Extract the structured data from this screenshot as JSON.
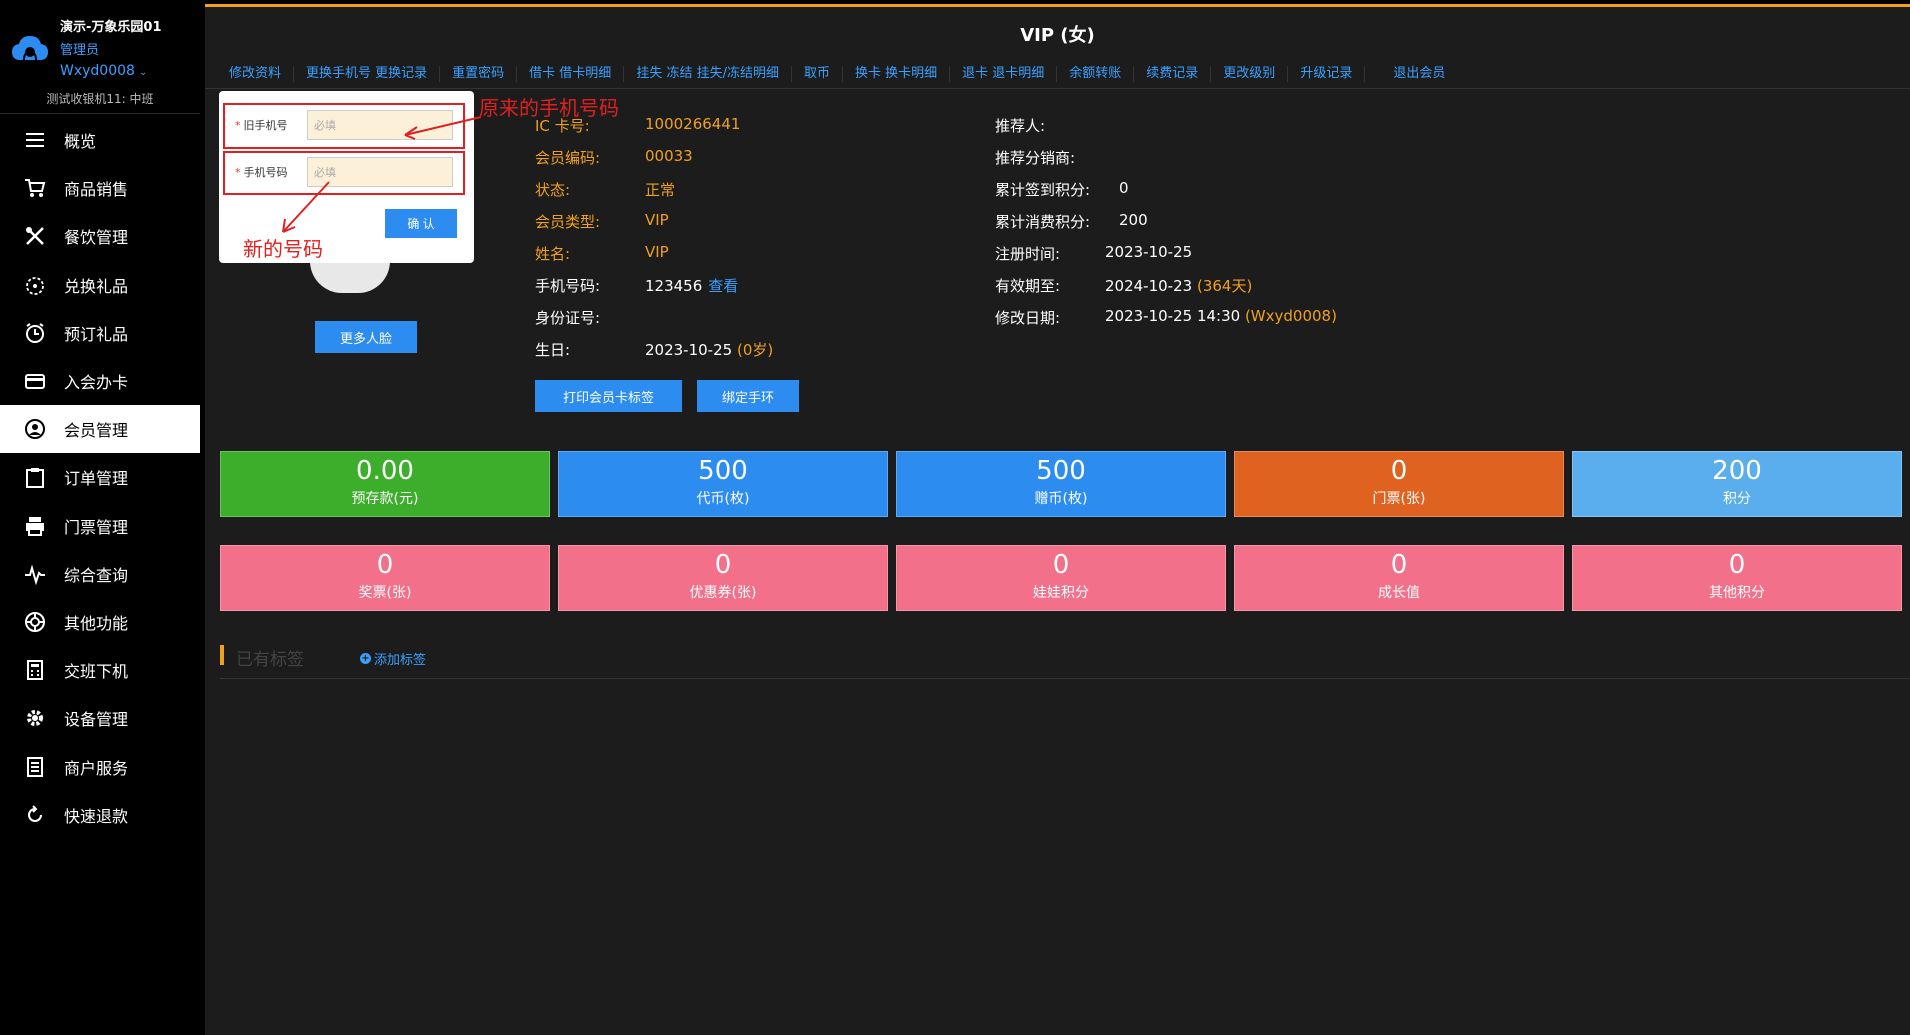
{
  "brand": {
    "store": "演示-万象乐园01",
    "role": "管理员",
    "user": "Wxyd0008",
    "terminal": "测试收银机11: 中班"
  },
  "nav": [
    {
      "label": "概览",
      "icon": "menu-icon"
    },
    {
      "label": "商品销售",
      "icon": "cart-icon"
    },
    {
      "label": "餐饮管理",
      "icon": "utensils-icon"
    },
    {
      "label": "兑换礼品",
      "icon": "gift-icon"
    },
    {
      "label": "预订礼品",
      "icon": "clock-icon"
    },
    {
      "label": "入会办卡",
      "icon": "card-icon"
    },
    {
      "label": "会员管理",
      "icon": "user-icon"
    },
    {
      "label": "订单管理",
      "icon": "clipboard-icon"
    },
    {
      "label": "门票管理",
      "icon": "printer-icon"
    },
    {
      "label": "综合查询",
      "icon": "pulse-icon"
    },
    {
      "label": "其他功能",
      "icon": "aperture-icon"
    },
    {
      "label": "交班下机",
      "icon": "calculator-icon"
    },
    {
      "label": "设备管理",
      "icon": "gear-icon"
    },
    {
      "label": "商户服务",
      "icon": "document-icon"
    },
    {
      "label": "快速退款",
      "icon": "refresh-icon"
    }
  ],
  "active_nav": "会员管理",
  "title": "VIP (女)",
  "tabs": [
    "修改资料",
    "更换手机号 更换记录",
    "重置密码",
    "借卡 借卡明细",
    "挂失 冻结 挂失/冻结明细",
    "取币",
    "换卡 换卡明细",
    "退卡 退卡明细",
    "余额转账",
    "续费记录",
    "更改级别",
    "升级记录",
    "退出会员"
  ],
  "popup": {
    "old_phone_label": "旧手机号",
    "new_phone_label": "手机号码",
    "placeholder": "必填",
    "confirm": "确 认",
    "annot_old": "原来的手机号码",
    "annot_new": "新的号码"
  },
  "more_face": "更多人脸",
  "info_left": [
    {
      "label": "IC 卡号:",
      "value": "1000266441",
      "label_color": "orange"
    },
    {
      "label": "会员编码:",
      "value": "00033",
      "label_color": "orange"
    },
    {
      "label": "状态:",
      "value": "正常",
      "label_color": "orange"
    },
    {
      "label": "会员类型:",
      "value": "VIP",
      "label_color": "orange"
    },
    {
      "label": "姓名:",
      "value": "VIP",
      "label_color": "orange"
    },
    {
      "label": "手机号码:",
      "value": "123456",
      "extra": "查看"
    },
    {
      "label": "身份证号:",
      "value": ""
    },
    {
      "label": "生日:",
      "value": "2023-10-25",
      "extra": "(0岁)"
    }
  ],
  "info_right": [
    {
      "label": "推荐人:",
      "value": ""
    },
    {
      "label": "推荐分销商:",
      "value": ""
    },
    {
      "label": "累计签到积分:",
      "value": "0"
    },
    {
      "label": "累计消费积分:",
      "value": "200"
    },
    {
      "label": "注册时间:",
      "value": "2023-10-25"
    },
    {
      "label": "有效期至:",
      "value": "2024-10-23",
      "extra": "(364天)"
    },
    {
      "label": "修改日期:",
      "value": "2023-10-25 14:30",
      "extra": "(Wxyd0008)"
    }
  ],
  "buttons": {
    "print": "打印会员卡标签",
    "bind": "绑定手环"
  },
  "cards_row1": [
    {
      "num": "0.00",
      "cap": "预存款(元)",
      "color": "#3dae2b"
    },
    {
      "num": "500",
      "cap": "代币(枚)",
      "color": "#2d8cf0"
    },
    {
      "num": "500",
      "cap": "赠币(枚)",
      "color": "#2d8cf0"
    },
    {
      "num": "0",
      "cap": "门票(张)",
      "color": "#e06220"
    },
    {
      "num": "200",
      "cap": "积分",
      "color": "#5aaeee"
    }
  ],
  "cards_row2": [
    {
      "num": "0",
      "cap": "奖票(张)",
      "color": "#f2708a"
    },
    {
      "num": "0",
      "cap": "优惠券(张)",
      "color": "#f2708a"
    },
    {
      "num": "0",
      "cap": "娃娃积分",
      "color": "#f2708a"
    },
    {
      "num": "0",
      "cap": "成长值",
      "color": "#f2708a"
    },
    {
      "num": "0",
      "cap": "其他积分",
      "color": "#f2708a"
    }
  ],
  "tags": {
    "label": "已有标签",
    "add": "添加标签"
  }
}
